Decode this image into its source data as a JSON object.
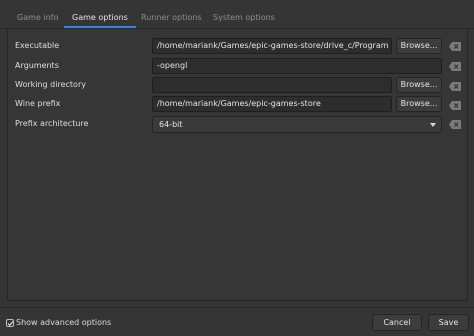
{
  "tabs": [
    {
      "label": "Game info"
    },
    {
      "label": "Game options"
    },
    {
      "label": "Runner options"
    },
    {
      "label": "System options"
    }
  ],
  "form": {
    "executable": {
      "label": "Executable",
      "value": "/home/mariank/Games/epic-games-store/drive_c/Program Files",
      "browse": "Browse..."
    },
    "arguments": {
      "label": "Arguments",
      "value": "-opengl"
    },
    "working_directory": {
      "label": "Working directory",
      "value": "",
      "browse": "Browse..."
    },
    "wine_prefix": {
      "label": "Wine prefix",
      "value": "/home/mariank/Games/epic-games-store",
      "browse": "Browse..."
    },
    "prefix_architecture": {
      "label": "Prefix architecture",
      "value": "64-bit"
    }
  },
  "footer": {
    "advanced_label": "Show advanced options",
    "advanced_checked": true,
    "cancel": "Cancel",
    "save": "Save"
  },
  "colors": {
    "accent": "#3584e4",
    "background": "#353535"
  }
}
